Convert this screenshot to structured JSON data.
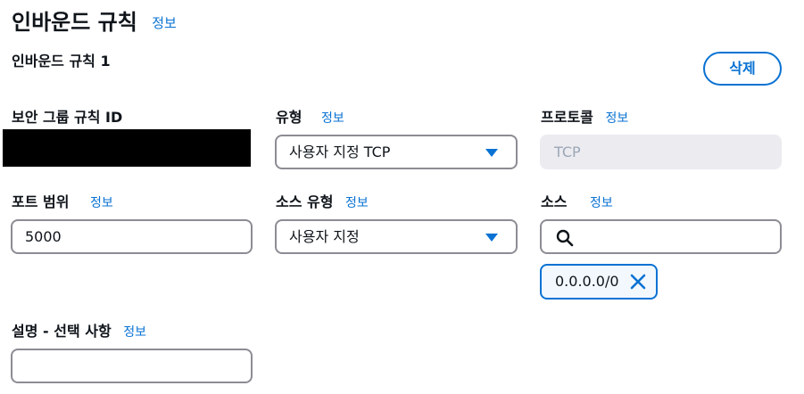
{
  "header": {
    "title": "인바운드 규칙",
    "info": "정보"
  },
  "rule": {
    "title": "인바운드 규칙 1",
    "delete_label": "삭제",
    "security_group_rule_id": {
      "label": "보안 그룹 규칙 ID"
    },
    "type": {
      "label": "유형",
      "info": "정보",
      "value": "사용자 지정 TCP"
    },
    "protocol": {
      "label": "프로토콜",
      "info": "정보",
      "value": "TCP"
    },
    "port_range": {
      "label": "포트 범위",
      "info": "정보",
      "value": "5000"
    },
    "source_type": {
      "label": "소스 유형",
      "info": "정보",
      "value": "사용자 지정"
    },
    "source": {
      "label": "소스",
      "info": "정보",
      "search_value": "",
      "tokens": [
        "0.0.0.0/0"
      ]
    },
    "description": {
      "label": "설명 - 선택 사항",
      "info": "정보",
      "value": ""
    }
  },
  "colors": {
    "link": "#0972d3",
    "border": "#8c8c94",
    "disabled_bg": "#ebebf0",
    "token_bg": "#f2f8fd"
  },
  "icons": {
    "select_caret": "caret-down-icon",
    "search": "search-icon",
    "token_remove": "close-icon"
  }
}
